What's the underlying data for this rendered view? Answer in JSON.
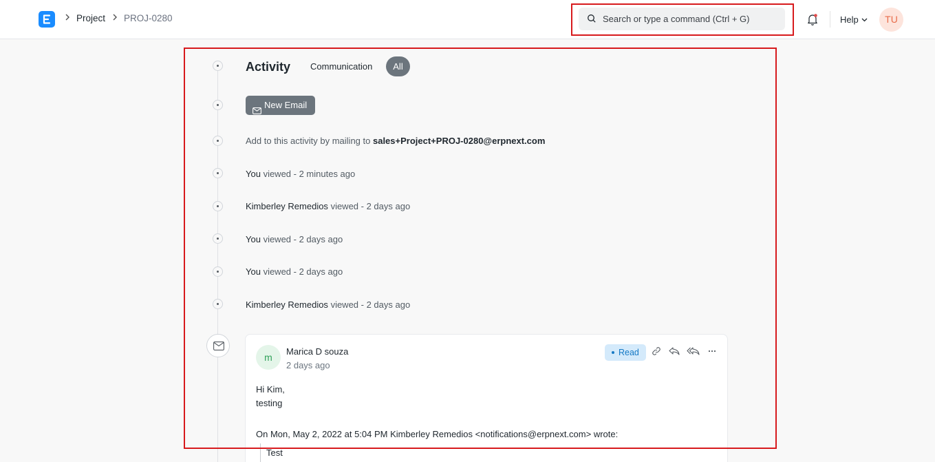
{
  "navbar": {
    "breadcrumbs": [
      "Project",
      "PROJ-0280"
    ],
    "search": {
      "placeholder": "Search or type a command (Ctrl + G)"
    },
    "help_label": "Help",
    "avatar_initials": "TU",
    "icons": [
      "app-logo-icon",
      "chevron-right-icon",
      "search-icon",
      "bell-icon",
      "chevron-down-icon"
    ]
  },
  "activity": {
    "title": "Activity",
    "tabs": [
      {
        "label": "Communication",
        "active": false
      },
      {
        "label": "All",
        "active": true
      }
    ],
    "new_email_label": "New Email",
    "mailing": {
      "prefix": "Add to this activity by mailing to",
      "address": "sales+Project+PROJ-0280@erpnext.com"
    },
    "items": [
      {
        "user": "You",
        "text": "viewed - 2 minutes ago"
      },
      {
        "user": "Kimberley Remedios",
        "text": "viewed - 2 days ago"
      },
      {
        "user": "You",
        "text": "viewed - 2 days ago"
      },
      {
        "user": "You",
        "text": "viewed - 2 days ago"
      },
      {
        "user": "Kimberley Remedios",
        "text": "viewed - 2 days ago"
      }
    ],
    "email": {
      "avatar_initial": "m",
      "sender": "Marica D souza",
      "time": "2 days ago",
      "status": "Read",
      "body_lines": [
        "Hi Kim,",
        "testing"
      ],
      "quote_header": "On Mon, May 2, 2022 at 5:04 PM Kimberley Remedios <notifications@erpnext.com> wrote:",
      "quote_text": "Test",
      "icons": [
        "link-icon",
        "reply-icon",
        "reply-all-icon",
        "more-icon"
      ]
    }
  },
  "colors": {
    "accent": "#1a8cff",
    "highlight_border": "#d7191c",
    "pill_active": "#6c757d",
    "read_badge_bg": "#d4eafb",
    "read_badge_text": "#1579c5"
  }
}
